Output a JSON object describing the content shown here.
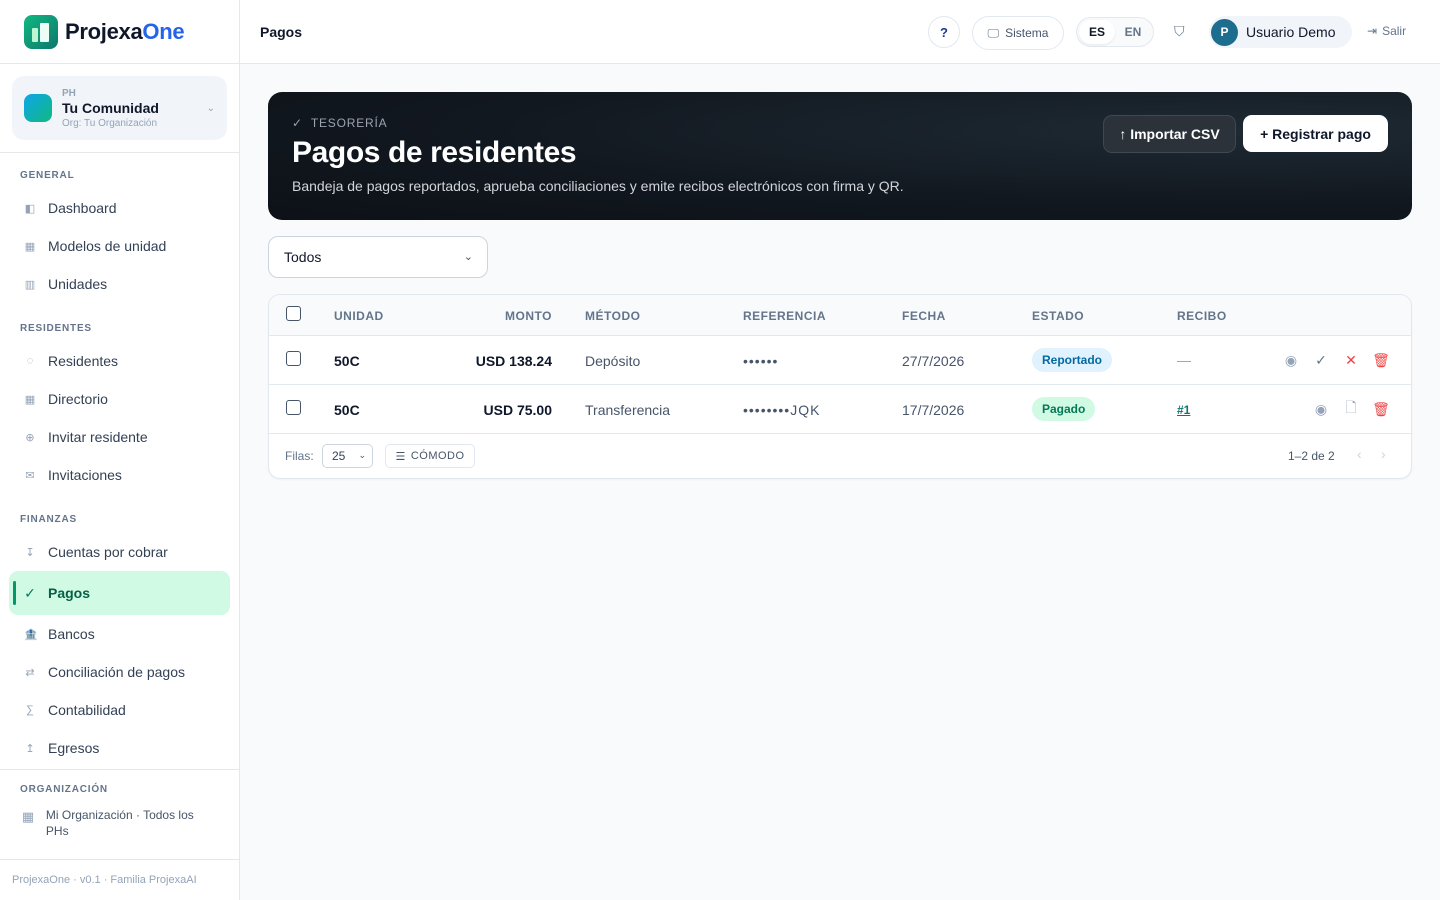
{
  "brand": {
    "name_main": "Projexa",
    "name_accent": "One"
  },
  "community": {
    "type": "PH",
    "name": "Tu Comunidad",
    "org": "Org: Tu Organización"
  },
  "nav": {
    "general": {
      "title": "GENERAL",
      "items": [
        {
          "label": "Dashboard",
          "icon": "◧"
        },
        {
          "label": "Modelos de unidad",
          "icon": "▦"
        },
        {
          "label": "Unidades",
          "icon": "▥"
        }
      ]
    },
    "residentes": {
      "title": "RESIDENTES",
      "items": [
        {
          "label": "Residentes",
          "icon": "◌"
        },
        {
          "label": "Directorio",
          "icon": "▦"
        },
        {
          "label": "Invitar residente",
          "icon": "⊕"
        },
        {
          "label": "Invitaciones",
          "icon": "✉"
        }
      ]
    },
    "finanzas": {
      "title": "FINANZAS",
      "items": [
        {
          "label": "Cuentas por cobrar",
          "icon": "↧"
        },
        {
          "label": "Pagos",
          "icon": "✓"
        },
        {
          "label": "Bancos",
          "icon": "🏦"
        },
        {
          "label": "Conciliación de pagos",
          "icon": "⇄"
        },
        {
          "label": "Contabilidad",
          "icon": "∑"
        },
        {
          "label": "Egresos",
          "icon": "↥"
        }
      ]
    },
    "organizacion": {
      "title": "ORGANIZACIÓN",
      "item": "Mi Organización · Todos los PHs",
      "icon": "▦"
    }
  },
  "version": "ProjexaOne · v0.1 · Familia ProjexaAI",
  "header": {
    "crumb": "Pagos",
    "help": "?",
    "theme": "Sistema",
    "lang_es": "ES",
    "lang_en": "EN",
    "user_initial": "P",
    "user_name": "Usuario Demo",
    "logout": "Salir"
  },
  "hero": {
    "eyebrow": "TESORERÍA",
    "title": "Pagos de residentes",
    "subtitle": "Bandeja de pagos reportados, aprueba conciliaciones y emite recibos electrónicos con firma y QR.",
    "import_label": "↑ Importar CSV",
    "register_label": "+ Registrar pago"
  },
  "filter": {
    "value": "Todos"
  },
  "table": {
    "columns": {
      "unidad": "UNIDAD",
      "monto": "MONTO",
      "metodo": "MÉTODO",
      "referencia": "REFERENCIA",
      "fecha": "FECHA",
      "estado": "ESTADO",
      "recibo": "RECIBO"
    },
    "rows": [
      {
        "unidad": "50C",
        "monto": "USD 138.24",
        "metodo": "Depósito",
        "referencia": "••••••",
        "fecha": "27/7/2026",
        "estado": "Reportado",
        "recibo": "—"
      },
      {
        "unidad": "50C",
        "monto": "USD 75.00",
        "metodo": "Transferencia",
        "referencia": "••••••••JQK",
        "fecha": "17/7/2026",
        "estado": "Pagado",
        "recibo": "#1"
      }
    ],
    "footer": {
      "rows_label": "Filas:",
      "rows_value": "25",
      "density": "CÓMODO",
      "range": "1–2 de 2"
    }
  },
  "colors": {
    "accent": "#059669",
    "active_bg": "#d1fae5",
    "hero_bg": "#0d1117",
    "danger": "#ef4444"
  }
}
